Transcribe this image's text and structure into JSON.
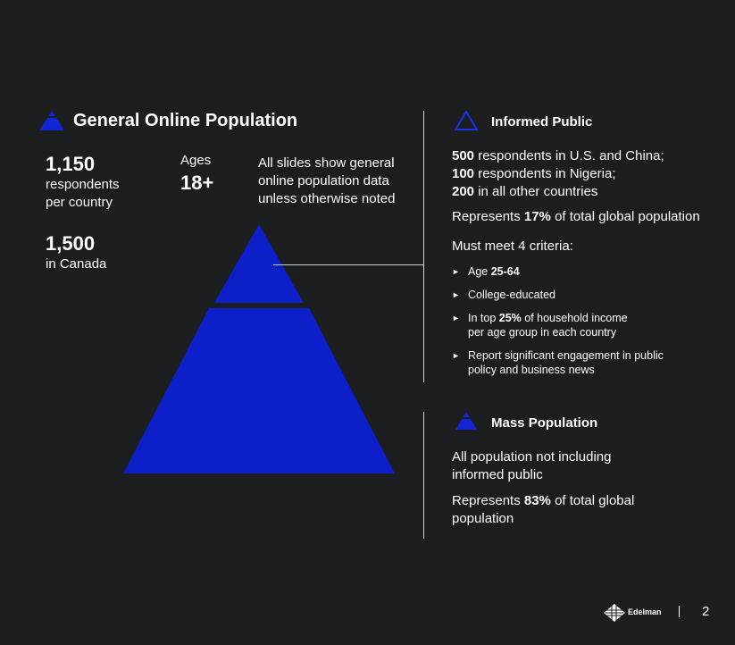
{
  "title": "General Online Population",
  "stats": {
    "main_number": "1,150",
    "main_label_1": "respondents",
    "main_label_2": "per country",
    "canada_number": "1,500",
    "canada_label": "in Canada",
    "ages_label": "Ages",
    "ages_value": "18+",
    "note_1": "All slides show general",
    "note_2": "online population data",
    "note_3": "unless otherwise noted"
  },
  "informed_public": {
    "title": "Informed Public",
    "line1_num": "500",
    "line1_text": " respondents in U.S. and China;",
    "line2_num": "100",
    "line2_text": " respondents in Nigeria;",
    "line3_num": "200",
    "line3_text": " in all other countries",
    "represents_pre": "Represents ",
    "represents_pct": "17%",
    "represents_post": " of total global population",
    "criteria_heading": "Must meet 4 criteria:",
    "criteria": [
      {
        "pre": "Age ",
        "bold": "25-64",
        "post": ""
      },
      {
        "pre": "College-educated",
        "bold": "",
        "post": ""
      },
      {
        "pre": "In top ",
        "bold": "25%",
        "post": " of household income",
        "line2": "per age group in each country"
      },
      {
        "pre": "Report significant engagement in public",
        "bold": "",
        "post": "",
        "line2": "policy and business news"
      }
    ]
  },
  "mass_population": {
    "title": "Mass Population",
    "desc_1": "All population not including",
    "desc_2": "informed public",
    "represents_pre": "Represents ",
    "represents_pct": "83%",
    "represents_post": " of total global",
    "represents_line2": "population"
  },
  "footer": {
    "brand": "Edelman",
    "page": "2"
  },
  "colors": {
    "background": "#1b1d1f",
    "pyramid": "#0d1fc8",
    "text": "#ffffff",
    "line": "#cfd2d6"
  },
  "icons": {
    "title_icon": "pyramid-icon",
    "informed_icon": "pyramid-outline-icon",
    "mass_icon": "pyramid-base-icon",
    "logo": "edelman-logo-icon"
  }
}
